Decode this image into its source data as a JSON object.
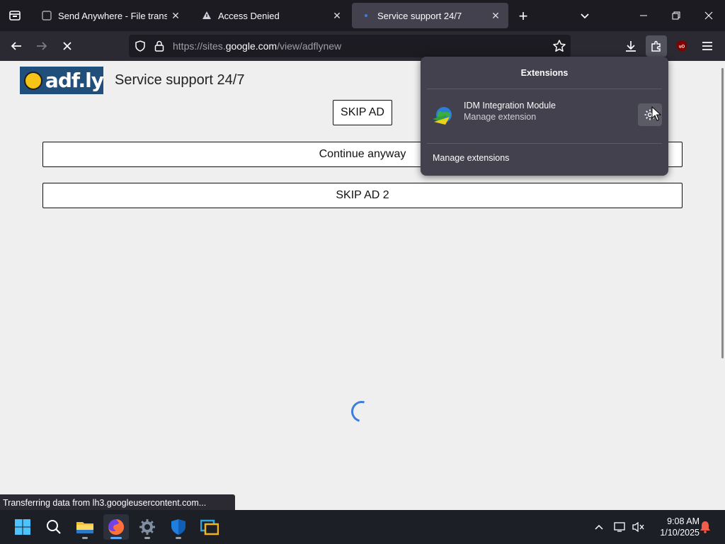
{
  "tabs": [
    {
      "title": "Send Anywhere - File transfer",
      "active": false
    },
    {
      "title": "Access Denied",
      "active": false
    },
    {
      "title": "Service support 24/7",
      "active": true
    }
  ],
  "urlbar": {
    "url_prefix": "https://sites.",
    "url_domain": "google.com",
    "url_path": "/view/adflynew"
  },
  "page": {
    "logo_text": "adf.ly",
    "title": "Service support 24/7",
    "skip_ad": "SKIP AD",
    "continue": "Continue anyway",
    "skip_ad_2": "SKIP AD 2"
  },
  "status": {
    "text": "Transferring data from lh3.googleusercontent.com..."
  },
  "extensions_panel": {
    "header": "Extensions",
    "items": [
      {
        "name": "IDM Integration Module",
        "subtitle": "Manage extension"
      }
    ],
    "manage_label": "Manage extensions"
  },
  "taskbar": {
    "time": "9:08 AM",
    "date": "1/10/2025",
    "apps": [
      "start-icon",
      "search-icon",
      "file-explorer-icon",
      "firefox-icon",
      "settings-icon",
      "defender-icon",
      "remote-desktop-icon"
    ]
  },
  "colors": {
    "tabstrip": "#1c1b22",
    "navbar": "#2b2a33",
    "panel": "#42414d",
    "accent": "#3d7ddb",
    "adfly_blue": "#1f4f7a"
  }
}
